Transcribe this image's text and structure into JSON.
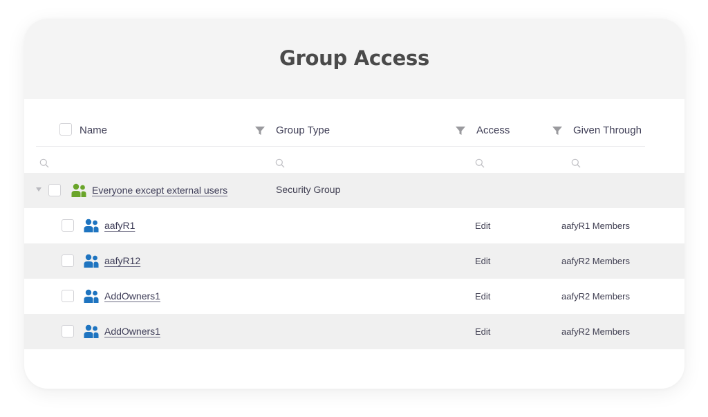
{
  "title": "Group Access",
  "columns": {
    "name": "Name",
    "group_type": "Group Type",
    "access": "Access",
    "given_through": "Given Through"
  },
  "icons": {
    "filter": "filter-icon",
    "search": "search-icon",
    "group": "group-icon",
    "expand": "caret-down-icon"
  },
  "colors": {
    "group_parent": "#6aa52a",
    "group_child": "#1e74c0",
    "row_alt": "#f0f0f0",
    "header_bg": "#f4f4f4"
  },
  "rows": [
    {
      "name": "Everyone except external users",
      "group_type": "Security Group",
      "access": "",
      "given_through": "",
      "expanded": true,
      "level": 0
    },
    {
      "name": "aafyR1",
      "group_type": "",
      "access": "Edit",
      "given_through": "aafyR1 Members",
      "level": 1
    },
    {
      "name": "aafyR12",
      "group_type": "",
      "access": "Edit",
      "given_through": "aafyR2 Members",
      "level": 1
    },
    {
      "name": "AddOwners1",
      "group_type": "",
      "access": "Edit",
      "given_through": "aafyR2 Members",
      "level": 1
    },
    {
      "name": "AddOwners1",
      "group_type": "",
      "access": "Edit",
      "given_through": "aafyR2 Members",
      "level": 1
    }
  ]
}
